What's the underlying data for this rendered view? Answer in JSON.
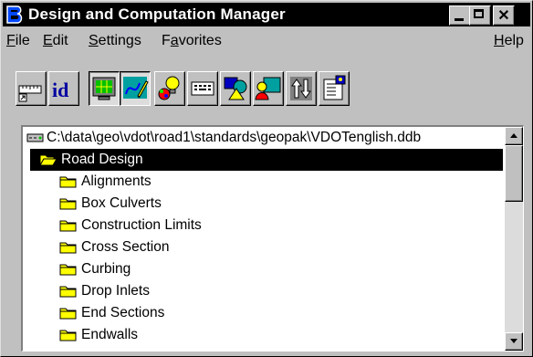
{
  "window": {
    "title": "Design and Computation Manager",
    "title_icon": "geopak-b-logo-icon",
    "controls": [
      "minimize",
      "maximize",
      "close"
    ]
  },
  "menubar": {
    "items": [
      {
        "label": "File",
        "accelerator": "F"
      },
      {
        "label": "Edit",
        "accelerator": "E"
      },
      {
        "label": "Settings",
        "accelerator": "S"
      },
      {
        "label": "Favorites",
        "accelerator": "a"
      },
      {
        "label": "Help",
        "accelerator": "H"
      }
    ]
  },
  "toolbar": {
    "tools": [
      {
        "icon": "ruler-shortcut-icon",
        "pressed": false
      },
      {
        "icon": "id-icon",
        "pressed": false
      },
      {
        "icon": "monitor-grid-icon",
        "pressed": true
      },
      {
        "icon": "pencil-curve-icon",
        "pressed": true
      },
      {
        "icon": "palette-bulb-icon",
        "pressed": false
      },
      {
        "icon": "keyboard-icon",
        "pressed": false
      },
      {
        "icon": "shapes-icon",
        "pressed": false
      },
      {
        "icon": "person-monitor-icon",
        "pressed": false
      },
      {
        "icon": "arrows-updown-icon",
        "pressed": false
      },
      {
        "icon": "properties-sheet-icon",
        "pressed": false
      }
    ]
  },
  "tree": {
    "path": "C:\\data\\geo\\vdot\\road1\\standards\\geopak\\VDOTenglish.ddb",
    "path_icon": "database-drive-icon",
    "selected": "Road Design",
    "folders": [
      "Alignments",
      "Box Culverts",
      "Construction Limits",
      "Cross Section",
      "Curbing",
      "Drop Inlets",
      "End Sections",
      "Endwalls"
    ]
  },
  "colors": {
    "titlebar": "#000000",
    "selection": "#000000",
    "folder": "#ffff00",
    "face": "#c0c0c0"
  }
}
